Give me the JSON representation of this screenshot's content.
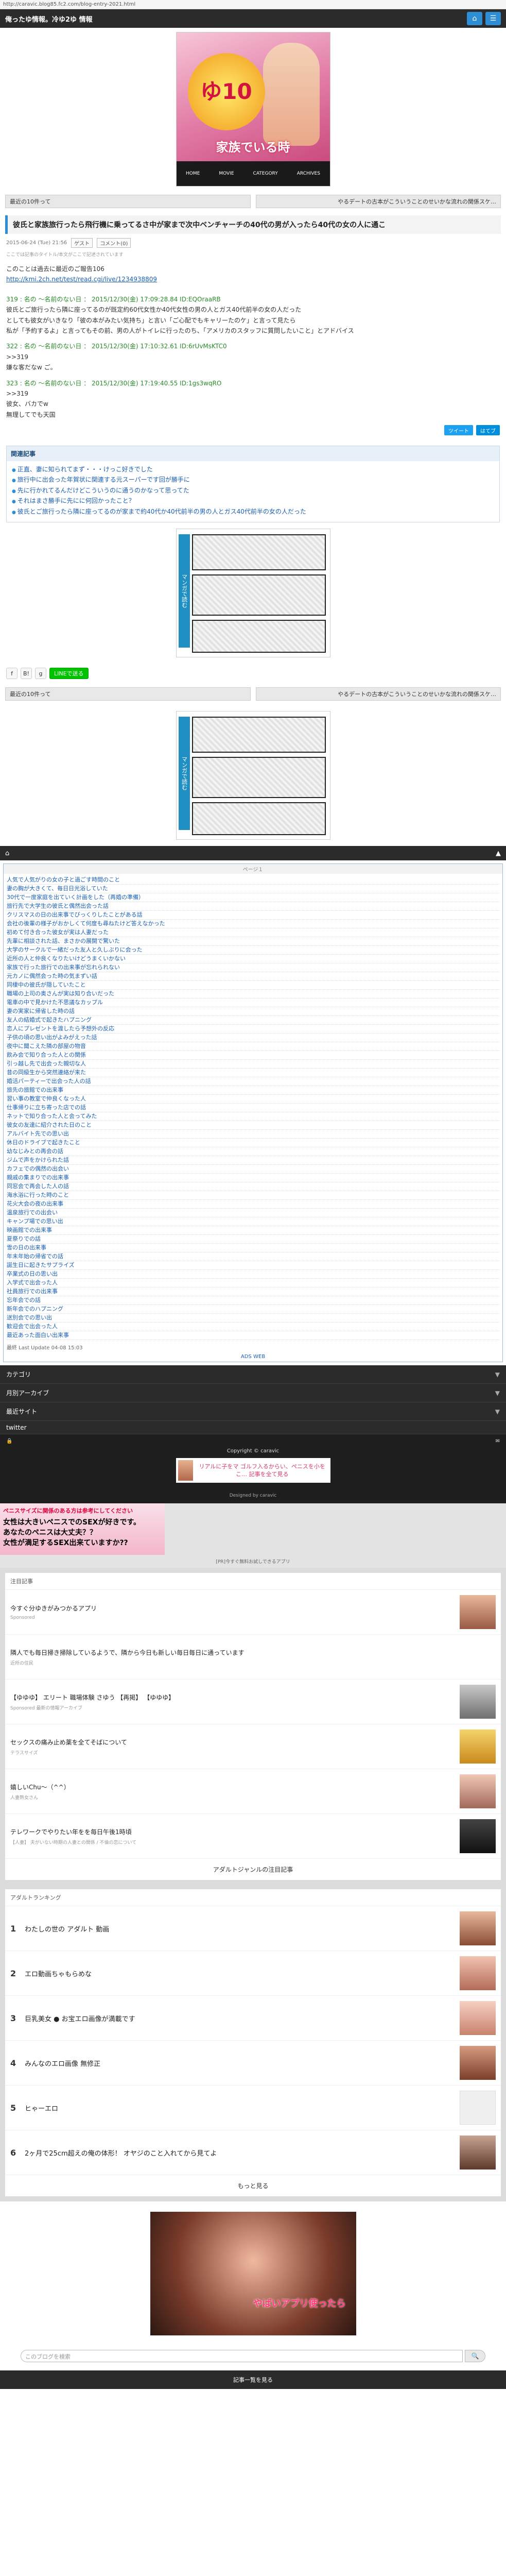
{
  "url": "http://caravic.blog85.fc2.com/blog-entry-2021.html",
  "site_title": "俺ったゆ情報。冷ゆ2ゆ 情報",
  "top_icons": [
    "home-icon",
    "menu-icon"
  ],
  "banner": {
    "circle_text": "ゆ10",
    "bottom_text": "家族でいる時",
    "ribbon": [
      "HOME",
      "MOVIE",
      "CATEGORY",
      "ARCHIVES"
    ]
  },
  "nav": {
    "prev": "最近の10件って",
    "next": "やるデートの古本がこういうことのせいかな流れの関係スケ…"
  },
  "article": {
    "title": "彼氏と家族旅行ったら飛行機に乗ってるさ中が家まで次中ベンチャーチの40代の男が入ったら40代の女の人に通こ",
    "date": "2015-06-24 (Tue) 21:56",
    "tag": "ゲスト",
    "tag2": "コメント(0)",
    "note": "ここでは記事のタイトル/本文がここで記述されています",
    "intro_line1": "このことは過去に最近のご報告106",
    "intro_link": "http://kmi.2ch.net/test/read.cgi/live/1234938809",
    "intro_line2": "",
    "post1_head": "319 : 名の 〜名前のない日 ： 2015/12/30(金) 17:09:28.84 ID:EQOraaRB",
    "post1_text": "彼氏とご旅行ったら隣に座ってるのが既定約60代女性か40代女性の男の人とガス40代前半の女の人だった\nとしても彼女がいきなり「彼の本がみたい気持ち」と言い「ご心配でもキャリーたのケ」と言って見たら\n私が「予約するよ」と言ってもその前、男の人がトイレに行ったのち、「アメリカのスタッフに質問したいこと」とアドバイス",
    "post2_head": "322 : 名の 〜名前のない日 ： 2015/12/30(金) 17:10:32.61 ID:6rUvMsKTC0",
    "post2_text": ">>319\n嫌な客だなw ご。",
    "post3_head": "323 : 名の 〜名前のない日 ： 2015/12/30(金) 17:19:40.55 ID:1gs3wqRO",
    "post3_text": ">>319\n彼女、バカでw\n無理してでも天国"
  },
  "share": {
    "tweet": "ツイート",
    "hatena": "はてブ"
  },
  "related": {
    "heading": "関連記事",
    "items": [
      "正直、妻に知られてまず・・・けっこ好きでした",
      "旅行中に出会った年賀状に関連する元スーパーです回が勝手に",
      "先に行かれてるんだけどこういうのに通うのかなって思ってた",
      "それはまさ勝手に先にに何回かったこと？",
      "彼氏とご旅行ったら隣に座ってるのが家まで約40代か40代前半の男の人とガス40代前半の女の人だった"
    ]
  },
  "comic_ad": {
    "side_text": "マンガで読む"
  },
  "social": {
    "line_label": "LINEで送る",
    "f": "f",
    "b": "B!",
    "g": "g"
  },
  "footer_nav": {
    "home": "⌂",
    "up": "▲"
  },
  "rss": {
    "head": "ページ１",
    "items": [
      "人気で人気がりの女の子と過ごす時間のこと",
      "妻の胸が大きくて、毎日日光浴していた",
      "30代で一度家庭を出ていく計画をした（再婚の準備）",
      "旅行先で大学生の彼氏と偶然出会った話",
      "クリスマスの日の出来事でびっくりしたことがある話",
      "会社の後輩の様子がおかしくて何度も尋ねたけど答えなかった",
      "初めて付き合った彼女が実は人妻だった",
      "先輩に相談された話、まさかの展開で驚いた",
      "大学のサークルで一緒だった友人と久しぶりに会った",
      "近所の人と仲良くなりたいけどうまくいかない",
      "家族で行った旅行での出来事が忘れられない",
      "元カノに偶然会った時の気まずい話",
      "同棲中の彼氏が隠していたこと",
      "職場の上司の奥さんが実は知り合いだった",
      "電車の中で見かけた不思議なカップル",
      "妻の実家に帰省した時の話",
      "友人の結婚式で起きたハプニング",
      "恋人にプレゼントを渡したら予想外の反応",
      "子供の頃の思い出がよみがえった話",
      "夜中に聞こえた隣の部屋の物音",
      "飲み会で知り合った人との関係",
      "引っ越し先で出会った親切な人",
      "昔の同級生から突然連絡が来た",
      "婚活パーティーで出会った人の話",
      "旅先の旅館での出来事",
      "習い事の教室で仲良くなった人",
      "仕事帰りに立ち寄った店での話",
      "ネットで知り合った人と会ってみた",
      "彼女の友達に紹介された日のこと",
      "アルバイト先での思い出",
      "休日のドライブで起きたこと",
      "幼なじみとの再会の話",
      "ジムで声をかけられた話",
      "カフェでの偶然の出会い",
      "親戚の集まりでの出来事",
      "同窓会で再会した人の話",
      "海水浴に行った時のこと",
      "花火大会の夜の出来事",
      "温泉旅行での出会い",
      "キャンプ場での思い出",
      "映画館での出来事",
      "夏祭りでの話",
      "雪の日の出来事",
      "年末年始の帰省での話",
      "誕生日に起きたサプライズ",
      "卒業式の日の思い出",
      "入学式で出会った人",
      "社員旅行での出来事",
      "忘年会での話",
      "新年会でのハプニング",
      "送別会での思い出",
      "歓迎会で出会った人",
      "最近あった面白い出来事"
    ],
    "updated": "最終 Last Update 04-08 15:03",
    "ads_link": "ADS WEB"
  },
  "dark_menu": {
    "rows": [
      "カテゴリ",
      "月別アーカイブ",
      "最近サイト"
    ],
    "twitter": "twitter"
  },
  "copyright": "Copyright © caravic",
  "friend_banner": "リアルに子をマ ゴルフ入るからい、ペニスを小をこ… 記事を全て見る",
  "designed": "Designed by caravic",
  "big_ad": {
    "l0": "ペニスサイズに関係のある方は参考にしてください",
    "l1": "女性は大きいペニスでのSEXが好きです。",
    "l2": "あなたのペニスは大丈夫？？",
    "l3": "女性が満足するSEX出来ていますか??"
  },
  "pr_note": "[PR]今すぐ無料お試しできるアプリ",
  "feed": {
    "title": "注目記事",
    "items": [
      {
        "title": "今すぐ分ゆきがみつかるアプリ",
        "sponsor": "Sponsored"
      },
      {
        "title": "隣人でも毎日掃き掃除しているようで、隣から今日も新しい毎日毎日に通っています",
        "sponsor": "近所の住民"
      },
      {
        "title": "【ゆゆゆ】 エリート 職場体験 さゆう 【再掲】 【ゆゆゆ】",
        "sponsor": "Sponsored  最新の情報アーカイブ"
      },
      {
        "title": "セックスの痛み止め薬を全てそばについて",
        "sponsor": "テラスサイズ"
      },
      {
        "title": "嬉しいChu～（^^）",
        "sponsor": "人妻熟女さん"
      },
      {
        "title": "テレワークでやりたい年をを毎日午後1時頃",
        "sponsor": "【人妻】 夫がいない時期の人妻との関係 / 不倫の恋について"
      }
    ],
    "more": "アダルトジャンルの注目記事"
  },
  "ranking": {
    "title": "アダルトランキング",
    "items": [
      "わたしの世の アダルト 動画",
      "エロ動画ちゃもらめな",
      "巨乳美女 ● お宝エロ画像が満載です",
      "みんなのエロ画像 無修正",
      "ヒゃーエロ",
      "2ヶ月で25cm超えの俺の体形！ オヤジのこと入れてから見てよ"
    ],
    "more": "もっと見る"
  },
  "bottom_ad_mark": "やばいアプリ使ったら",
  "search": {
    "placeholder": "このブログを検索",
    "button": "🔍"
  },
  "last_footer": "記事一覧を見る"
}
